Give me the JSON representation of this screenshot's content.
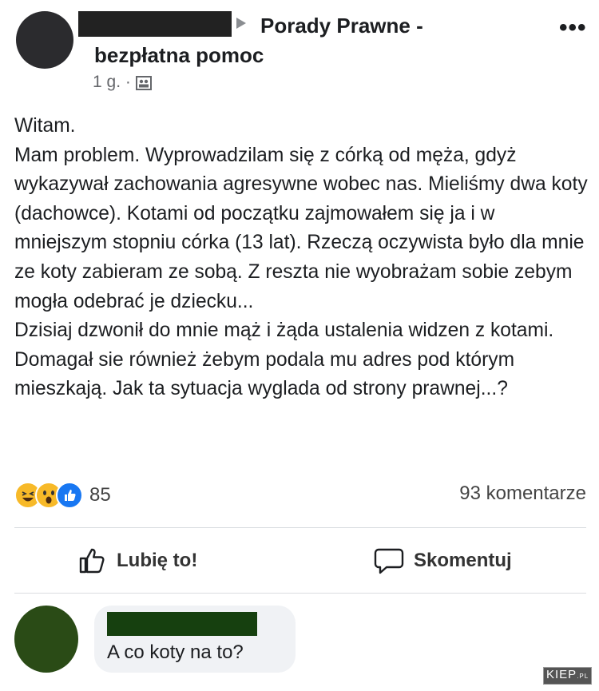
{
  "post": {
    "group_name_line1": "Porady Prawne -",
    "group_name_line2": "bezpłatna pomoc",
    "time": "1 g. ·",
    "audience_icon": "group-members-icon",
    "more_icon": "•••",
    "body": "Witam.\nMam problem. Wyprowadzilam się z córką od męża, gdyż wykazywał zachowania agresywne wobec nas. Mieliśmy dwa koty (dachowce). Kotami od początku zajmowałem się ja i w mniejszym stopniu córka (13 lat). Rzeczą oczywista było dla mnie ze koty zabieram ze sobą. Z reszta nie wyobrażam sobie zebym mogła odebrać je dziecku...\nDzisiaj dzwonił do mnie mąż i żąda ustalenia widzen z kotami. Domagał sie również żebym podala mu adres pod którym mieszkają. Jak ta sytuacja wyglada od strony prawnej...?"
  },
  "engagement": {
    "reaction_icons": [
      "haha-reaction-icon",
      "wow-reaction-icon",
      "like-reaction-icon"
    ],
    "reaction_count": "85",
    "comments_count": "93 komentarze"
  },
  "actions": {
    "like_label": "Lubię to!",
    "comment_label": "Skomentuj"
  },
  "comment": {
    "text": "A co koty na to?"
  },
  "watermark": {
    "text": "KIEP",
    "suffix": ".PL"
  },
  "colors": {
    "text": "#1c1e21",
    "secondary": "#65676b",
    "like_blue": "#1877f2",
    "reaction_yellow": "#f7b928",
    "bubble": "#f0f2f5"
  }
}
